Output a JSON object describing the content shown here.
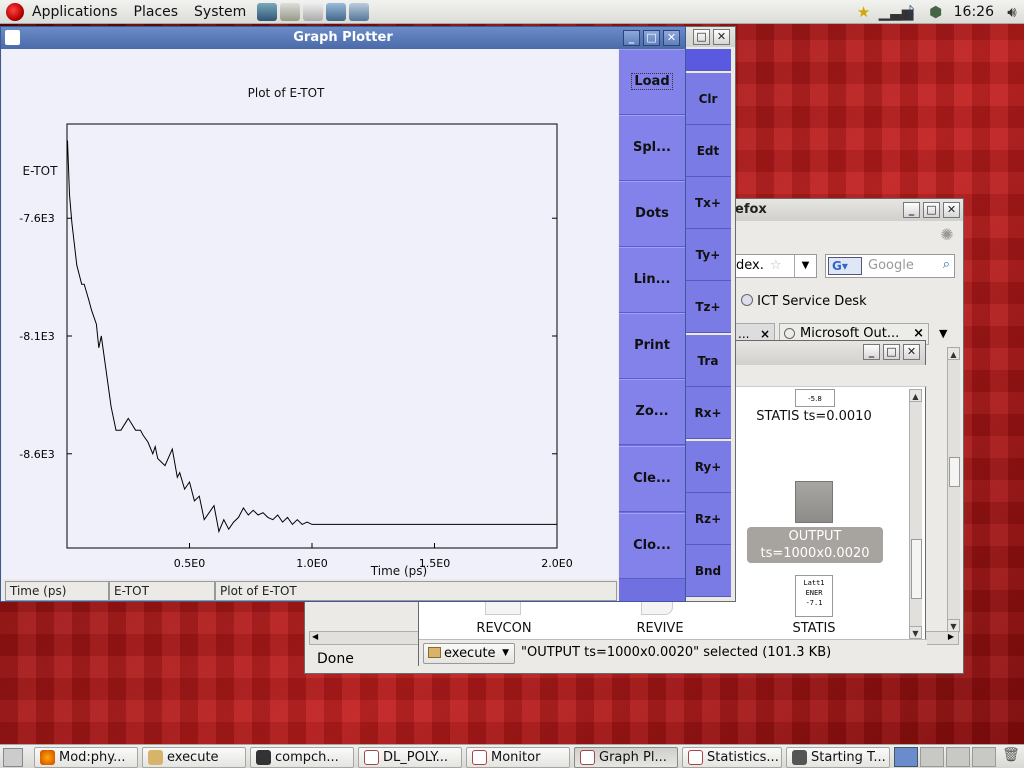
{
  "top_panel": {
    "menus": [
      "Applications",
      "Places",
      "System"
    ],
    "clock": "16:26"
  },
  "firefox": {
    "title": "efox",
    "url_partial": "dex.",
    "search_placeholder": "Google",
    "bookmark": "ICT Service Desk",
    "tabs": [
      "...",
      "Microsoft Out..."
    ],
    "status": "Done"
  },
  "file_browser": {
    "files": [
      {
        "name": "STATIS ts=0.0010",
        "thumb": "-5.8"
      },
      {
        "name": "OUTPUT ts=1000x0.0020",
        "selected": true
      },
      {
        "name": "REVCON"
      },
      {
        "name": "REVIVE"
      },
      {
        "name": "STATIS",
        "thumb_lines": [
          "Latt1",
          "ENER",
          "-7.1"
        ]
      }
    ],
    "location": "execute",
    "status": "\"OUTPUT ts=1000x0.0020\" selected (101.3 KB)"
  },
  "background_plotter": {
    "buttons": [
      "Clr",
      "Edt",
      "Tx+",
      "Ty+",
      "Tz+",
      "Tra",
      "Rx+",
      "Ry+",
      "Rz+",
      "Bnd"
    ]
  },
  "graph_plotter": {
    "title": "Graph Plotter",
    "buttons": [
      "Load",
      "Spl...",
      "Dots",
      "Lin...",
      "Print",
      "Zo...",
      "Cle...",
      "Clo..."
    ],
    "status": [
      "Time (ps)",
      "E-TOT",
      "Plot of E-TOT"
    ]
  },
  "chart_data": {
    "type": "line",
    "title": "Plot of E-TOT",
    "xlabel": "Time (ps)",
    "ylabel": "E-TOT",
    "xlim": [
      0.0,
      2.0
    ],
    "ylim": [
      -9.0,
      -7.2
    ],
    "x_ticks": [
      0.5,
      1.0,
      1.5,
      2.0
    ],
    "x_tick_labels": [
      "0.5E0",
      "1.0E0",
      "1.5E0",
      "2.0E0"
    ],
    "y_ticks": [
      -7.6,
      -8.1,
      -8.6
    ],
    "y_tick_labels": [
      "-7.6E3",
      "-8.1E3",
      "-8.6E3"
    ],
    "series": [
      {
        "x": [
          0.002,
          0.01,
          0.02,
          0.04,
          0.06,
          0.07,
          0.09,
          0.1,
          0.12,
          0.13,
          0.14,
          0.16,
          0.18,
          0.2,
          0.22,
          0.25,
          0.28,
          0.3,
          0.31,
          0.33,
          0.35,
          0.36,
          0.37,
          0.4,
          0.43,
          0.45,
          0.46,
          0.48,
          0.5,
          0.52,
          0.54,
          0.56,
          0.58,
          0.6,
          0.62,
          0.64,
          0.66,
          0.68,
          0.7,
          0.72,
          0.74,
          0.76,
          0.78,
          0.8,
          0.82,
          0.84,
          0.86,
          0.88,
          0.9,
          0.92,
          0.94,
          0.96,
          0.98,
          1.0,
          1.05,
          1.2,
          1.5,
          2.0
        ],
        "y": [
          -7.27,
          -7.5,
          -7.62,
          -7.8,
          -7.88,
          -7.88,
          -7.95,
          -7.99,
          -8.05,
          -8.15,
          -8.1,
          -8.25,
          -8.4,
          -8.5,
          -8.5,
          -8.45,
          -8.5,
          -8.5,
          -8.52,
          -8.55,
          -8.6,
          -8.57,
          -8.62,
          -8.65,
          -8.58,
          -8.7,
          -8.68,
          -8.75,
          -8.72,
          -8.8,
          -8.78,
          -8.88,
          -8.85,
          -8.82,
          -8.93,
          -8.88,
          -8.92,
          -8.89,
          -8.87,
          -8.83,
          -8.86,
          -8.84,
          -8.86,
          -8.85,
          -8.87,
          -8.88,
          -8.86,
          -8.89,
          -8.87,
          -8.9,
          -8.88,
          -8.9,
          -8.89,
          -8.9,
          -8.9,
          -8.9,
          -8.9,
          -8.9
        ]
      }
    ]
  }
}
